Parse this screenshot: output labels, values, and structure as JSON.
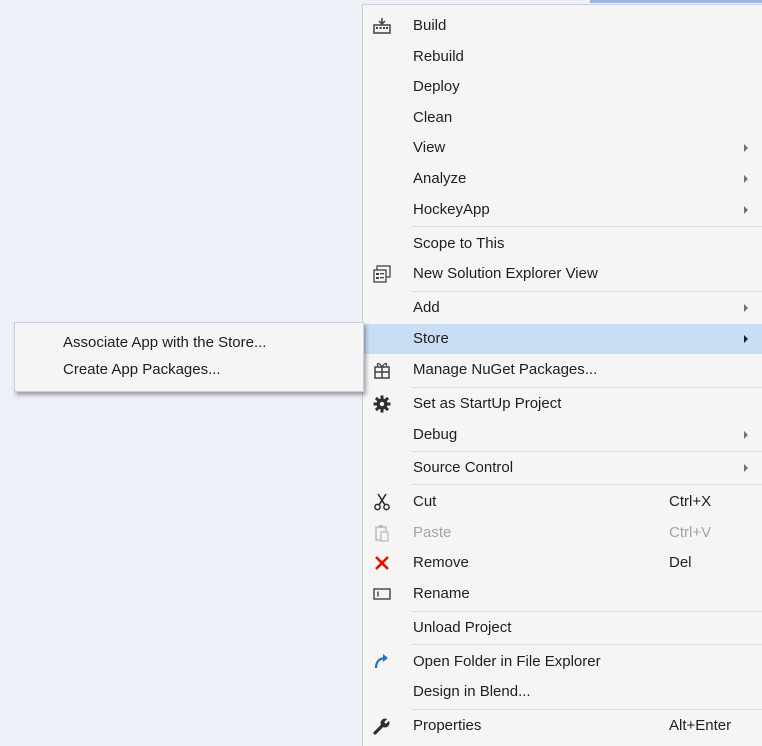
{
  "menu": {
    "items": [
      {
        "label": "Build"
      },
      {
        "label": "Rebuild"
      },
      {
        "label": "Deploy"
      },
      {
        "label": "Clean"
      },
      {
        "label": "View"
      },
      {
        "label": "Analyze"
      },
      {
        "label": "HockeyApp"
      },
      {
        "label": "Scope to This"
      },
      {
        "label": "New Solution Explorer View"
      },
      {
        "label": "Add"
      },
      {
        "label": "Store"
      },
      {
        "label": "Manage NuGet Packages..."
      },
      {
        "label": "Set as StartUp Project"
      },
      {
        "label": "Debug"
      },
      {
        "label": "Source Control"
      },
      {
        "label": "Cut",
        "shortcut": "Ctrl+X"
      },
      {
        "label": "Paste",
        "shortcut": "Ctrl+V"
      },
      {
        "label": "Remove",
        "shortcut": "Del"
      },
      {
        "label": "Rename"
      },
      {
        "label": "Unload Project"
      },
      {
        "label": "Open Folder in File Explorer"
      },
      {
        "label": "Design in Blend..."
      },
      {
        "label": "Properties",
        "shortcut": "Alt+Enter"
      }
    ]
  },
  "submenu": {
    "items": [
      {
        "label": "Associate App with the Store..."
      },
      {
        "label": "Create App Packages..."
      }
    ]
  },
  "colors": {
    "highlight": "#c9def5",
    "remove_icon": "#e51400",
    "open_folder_icon": "#1e6fc8",
    "disabled_text": "#a2a4a5"
  },
  "icons": {
    "build": "build-icon",
    "new_view": "new-solution-explorer-view-icon",
    "nuget": "nuget-package-icon",
    "startup": "gear-icon",
    "cut": "scissors-icon",
    "paste": "clipboard-icon",
    "remove": "red-x-icon",
    "rename": "rename-icon",
    "open_folder": "redo-arrow-icon",
    "properties": "wrench-icon"
  }
}
